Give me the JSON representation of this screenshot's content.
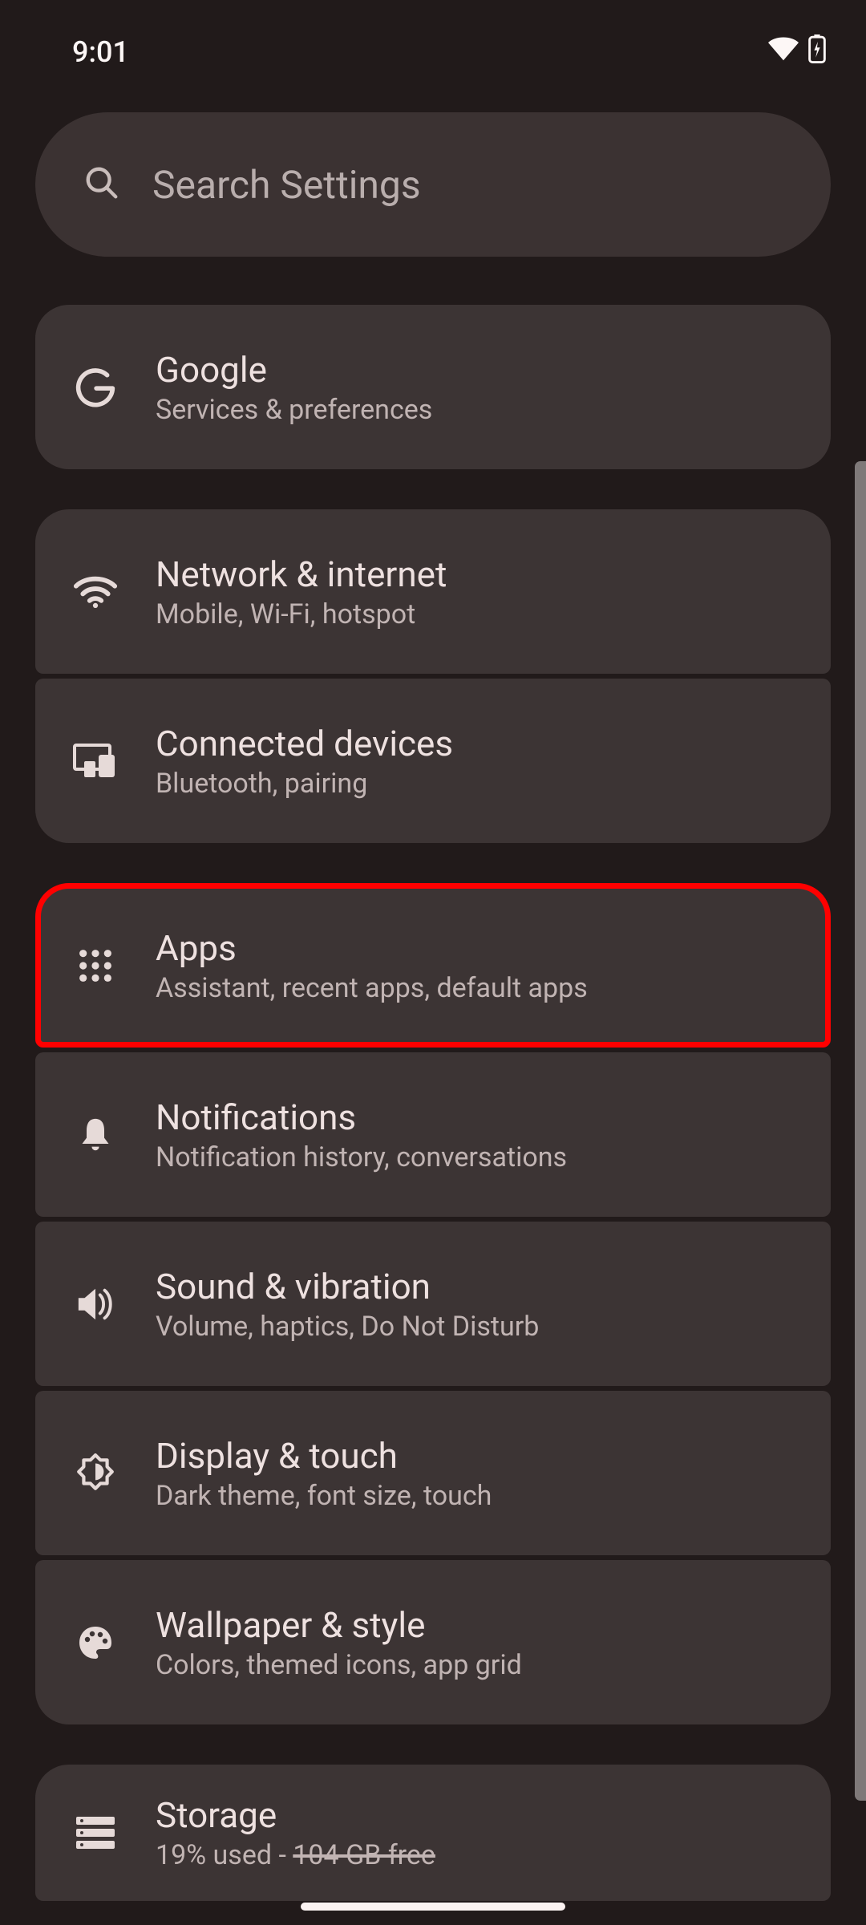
{
  "status": {
    "time": "9:01"
  },
  "search": {
    "placeholder": "Search Settings"
  },
  "group1": {
    "google": {
      "title": "Google",
      "sub": "Services & preferences"
    }
  },
  "group2": {
    "network": {
      "title": "Network & internet",
      "sub": "Mobile, Wi-Fi, hotspot"
    },
    "connected": {
      "title": "Connected devices",
      "sub": "Bluetooth, pairing"
    }
  },
  "group3": {
    "apps": {
      "title": "Apps",
      "sub": "Assistant, recent apps, default apps"
    },
    "notifications": {
      "title": "Notifications",
      "sub": "Notification history, conversations"
    },
    "sound": {
      "title": "Sound & vibration",
      "sub": "Volume, haptics, Do Not Disturb"
    },
    "display": {
      "title": "Display & touch",
      "sub": "Dark theme, font size, touch"
    },
    "wallpaper": {
      "title": "Wallpaper & style",
      "sub": "Colors, themed icons, app grid"
    }
  },
  "group4": {
    "storage": {
      "title": "Storage",
      "sub_prefix": "19% used - ",
      "sub_strike": "104 GB free"
    }
  }
}
